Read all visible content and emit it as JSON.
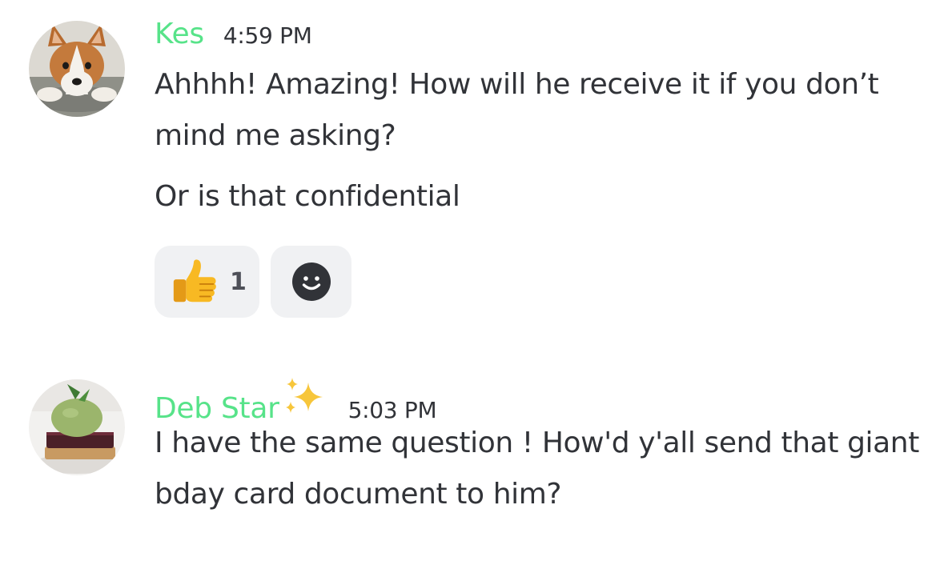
{
  "messages": [
    {
      "username": "Kes",
      "timestamp": "4:59 PM",
      "avatar_icon": "corgi-avatar",
      "lines": [
        "Ahhhh! Amazing! How will he receive it if you don’t mind me asking?",
        "Or is that confidential"
      ],
      "reactions": [
        {
          "emoji": "thumbs-up-icon",
          "count": "1"
        }
      ],
      "add_reaction_icon": "smiley-add-reaction-icon"
    },
    {
      "username": "Deb Star",
      "username_emoji": "sparkles-icon",
      "timestamp": "5:03 PM",
      "avatar_icon": "dessert-avatar",
      "lines": [
        "I have the same question ! How'd y'all send that giant bday card document to him?"
      ]
    }
  ],
  "colors": {
    "username": "#57e389",
    "text": "#313338",
    "reaction_bg": "#f0f1f3"
  }
}
